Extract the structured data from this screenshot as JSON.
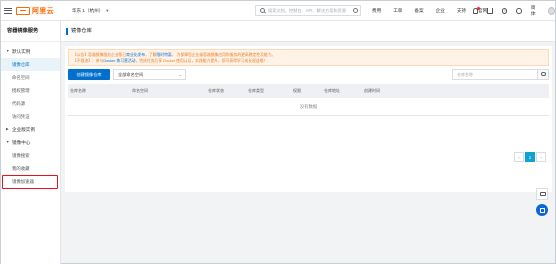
{
  "topbar": {
    "logo_text": "阿里云",
    "region": "华东 1（杭州）",
    "search_placeholder": "搜索文档、控制台、API、解决方案和资源",
    "links": [
      "费用",
      "工单",
      "备案",
      "企业",
      "支持",
      "官网"
    ],
    "lang": "简体"
  },
  "sidebar": {
    "title": "容器镜像服务",
    "groups": [
      {
        "label": "默认实例",
        "items": [
          "镜像仓库",
          "命名空间",
          "授权管理",
          "代码源",
          "访问凭证"
        ]
      },
      {
        "label": "企业版实例",
        "items": []
      },
      {
        "label": "镜像中心",
        "items": [
          "镜像搜索",
          "我的收藏",
          "镜像加速器"
        ]
      }
    ]
  },
  "main": {
    "page_title": "镜像仓库",
    "notice_line1_a": "【公告】容器镜像服务企业版已",
    "notice_line1_link1": "商业化发布",
    "notice_line1_b": "，了解",
    "notice_line1_link2": "限时特惠",
    "notice_line1_c": "。 为保障您企业级容器镜像应用和服务的更高稳定性及能力。",
    "notice_line2_a": "【不限流】：参与",
    "notice_line2_link": "Docker 练习营活动",
    "notice_line2_b": "，完成任务后享 Docker 使用认证，实践能力提升，即可获得学习成长权益哦！",
    "create_button": "创建镜像仓库",
    "namespace_select": "全部命名空间",
    "filter_placeholder": "仓库名称",
    "columns": [
      "仓库名称",
      "命名空间",
      "仓库状态",
      "仓库类型",
      "权限",
      "仓库地址",
      "创建时间"
    ],
    "empty_text": "没有数据",
    "pager": {
      "prev": "‹",
      "current": "1",
      "next": "›"
    }
  }
}
